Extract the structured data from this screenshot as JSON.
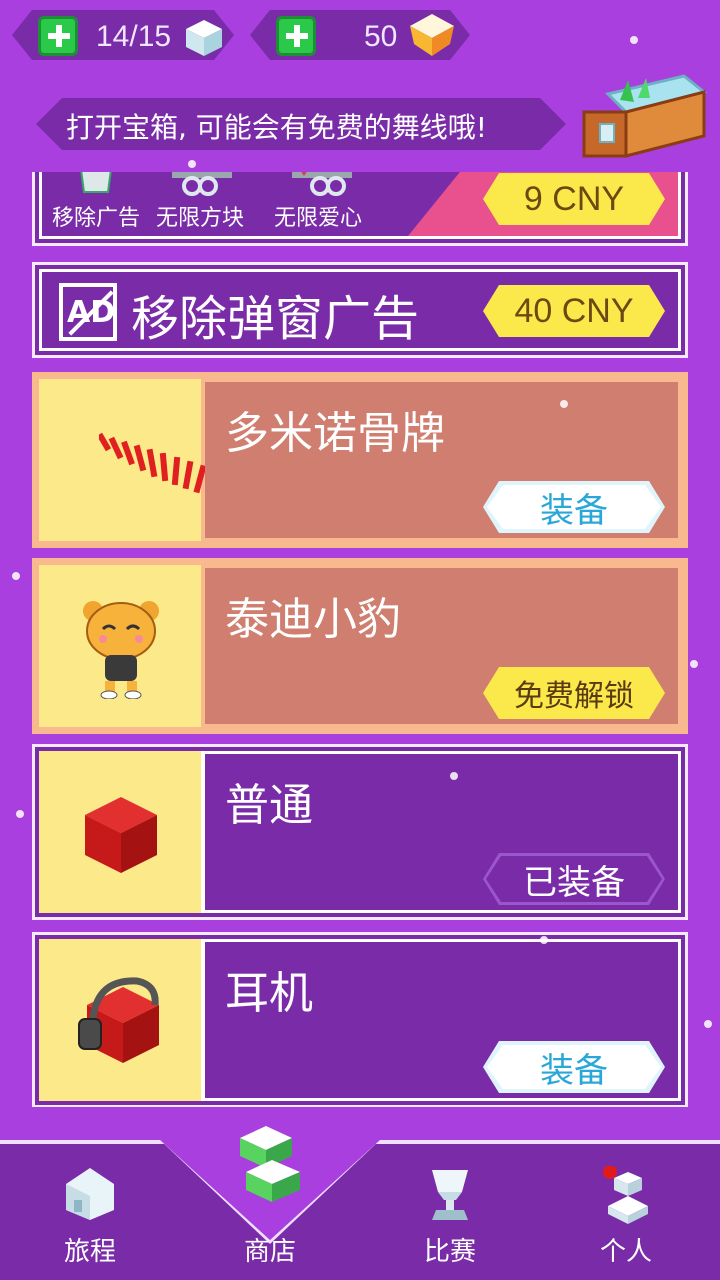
{
  "top": {
    "lives": "14/15",
    "gems": "50"
  },
  "banner": {
    "text": "打开宝箱, 可能会有免费的舞线哦!"
  },
  "bundle": {
    "features": [
      "移除广告",
      "无限方块",
      "无限爱心"
    ],
    "price": "9 CNY"
  },
  "remove_ads": {
    "icon_text": "AD",
    "title": "移除弹窗广告",
    "price": "40 CNY"
  },
  "items": [
    {
      "title": "多米诺骨牌",
      "button": "装备",
      "style": "peach",
      "icon": "domino-icon"
    },
    {
      "title": "泰迪小豹",
      "button": "免费解锁",
      "style": "peach",
      "icon": "leopard-icon"
    },
    {
      "title": "普通",
      "button": "已装备",
      "style": "purple",
      "icon": "red-cube-icon"
    },
    {
      "title": "耳机",
      "button": "装备",
      "style": "purple",
      "icon": "headphone-cube-icon"
    }
  ],
  "tabs": [
    {
      "label": "旅程",
      "icon": "house-icon"
    },
    {
      "label": "商店",
      "icon": "shop-icon"
    },
    {
      "label": "比赛",
      "icon": "trophy-icon"
    },
    {
      "label": "个人",
      "icon": "person-icon"
    }
  ],
  "colors": {
    "background": "#a83fde",
    "panel": "#7a2ca8",
    "price_yellow": "#fbe84a",
    "equip_blue": "#29a7d8"
  }
}
